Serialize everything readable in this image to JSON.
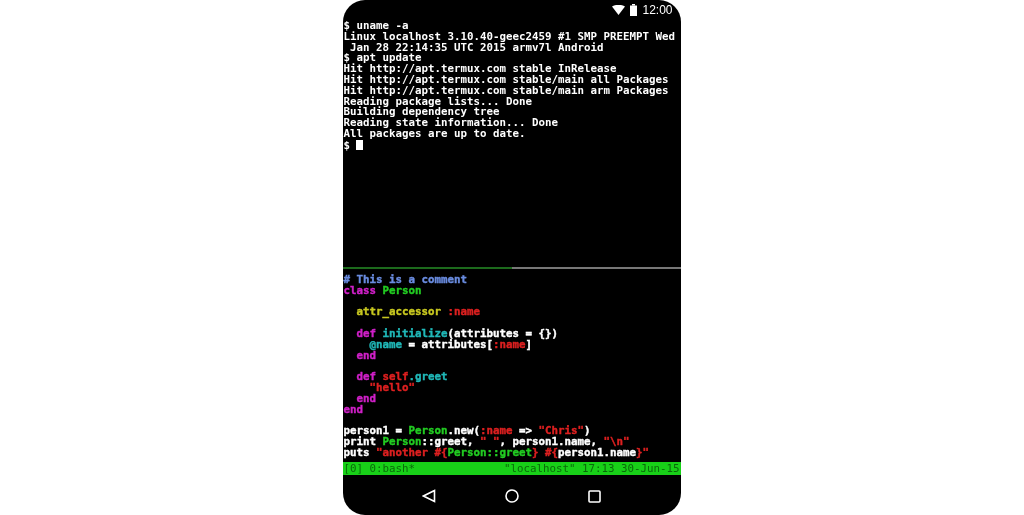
{
  "status_bar": {
    "time": "12:00"
  },
  "shell_pane": {
    "cursor_visible": true,
    "lines": [
      "$ uname -a",
      "Linux localhost 3.10.40-geec2459 #1 SMP PREEMPT Wed",
      " Jan 28 22:14:35 UTC 2015 armv7l Android",
      "$ apt update",
      "Hit http://apt.termux.com stable InRelease",
      "Hit http://apt.termux.com stable/main all Packages",
      "Hit http://apt.termux.com stable/main arm Packages",
      "Reading package lists... Done",
      "Building dependency tree",
      "Reading state information... Done",
      "All packages are up to date.",
      "$"
    ]
  },
  "editor_pane": {
    "lines": [
      {
        "kind": "code",
        "tokens": [
          {
            "text": "# This is a comment",
            "color": "#6a8ce0"
          }
        ]
      },
      {
        "kind": "code",
        "tokens": [
          {
            "text": "class",
            "color": "#d020c8"
          },
          {
            "text": " Person",
            "color": "#22cc22"
          }
        ]
      },
      {
        "kind": "blank"
      },
      {
        "kind": "code",
        "tokens": [
          {
            "text": "  attr_accessor",
            "color": "#c8c820"
          },
          {
            "text": " :name",
            "color": "#dd2020"
          }
        ]
      },
      {
        "kind": "blank"
      },
      {
        "kind": "code",
        "tokens": [
          {
            "text": "  def",
            "color": "#d020c8"
          },
          {
            "text": " initialize",
            "color": "#20b8b8"
          },
          {
            "text": "(attributes = {})",
            "color": "#ffffff"
          }
        ]
      },
      {
        "kind": "code",
        "tokens": [
          {
            "text": "    @name",
            "color": "#20b8b8"
          },
          {
            "text": " = attributes[",
            "color": "#ffffff"
          },
          {
            "text": ":name",
            "color": "#dd2020"
          },
          {
            "text": "]",
            "color": "#ffffff"
          }
        ]
      },
      {
        "kind": "code",
        "tokens": [
          {
            "text": "  end",
            "color": "#d020c8"
          }
        ]
      },
      {
        "kind": "blank"
      },
      {
        "kind": "code",
        "tokens": [
          {
            "text": "  def",
            "color": "#d020c8"
          },
          {
            "text": " self",
            "color": "#dd2020"
          },
          {
            "text": ".greet",
            "color": "#20b8b8"
          }
        ]
      },
      {
        "kind": "code",
        "tokens": [
          {
            "text": "    \"hello\"",
            "color": "#dd2020"
          }
        ]
      },
      {
        "kind": "code",
        "tokens": [
          {
            "text": "  end",
            "color": "#d020c8"
          }
        ]
      },
      {
        "kind": "code",
        "tokens": [
          {
            "text": "end",
            "color": "#d020c8"
          }
        ]
      },
      {
        "kind": "blank"
      },
      {
        "kind": "code",
        "tokens": [
          {
            "text": "person1 = ",
            "color": "#ffffff"
          },
          {
            "text": "Person",
            "color": "#22cc22"
          },
          {
            "text": ".new(",
            "color": "#ffffff"
          },
          {
            "text": ":name",
            "color": "#dd2020"
          },
          {
            "text": " => ",
            "color": "#ffffff"
          },
          {
            "text": "\"Chris\"",
            "color": "#dd2020"
          },
          {
            "text": ")",
            "color": "#ffffff"
          }
        ]
      },
      {
        "kind": "code",
        "tokens": [
          {
            "text": "print ",
            "color": "#ffffff"
          },
          {
            "text": "Person",
            "color": "#22cc22"
          },
          {
            "text": "::greet, ",
            "color": "#ffffff"
          },
          {
            "text": "\" \"",
            "color": "#dd2020"
          },
          {
            "text": ", person1.name, ",
            "color": "#ffffff"
          },
          {
            "text": "\"\\n\"",
            "color": "#dd2020"
          }
        ]
      },
      {
        "kind": "code",
        "tokens": [
          {
            "text": "puts ",
            "color": "#ffffff"
          },
          {
            "text": "\"another #{",
            "color": "#dd2020"
          },
          {
            "text": "Person::greet",
            "color": "#22cc22"
          },
          {
            "text": "} #{",
            "color": "#dd2020"
          },
          {
            "text": "person1.name",
            "color": "#ffffff"
          },
          {
            "text": "}\"",
            "color": "#dd2020"
          }
        ]
      }
    ]
  },
  "tmux_status": {
    "left": "[0] 0:bash*",
    "right": "\"localhost\" 17:13 30-Jun-15"
  }
}
